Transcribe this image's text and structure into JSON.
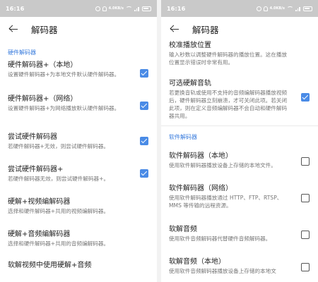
{
  "left": {
    "status": {
      "time": "16:16",
      "net": "4.0KB/s"
    },
    "title": "解码器",
    "section": "硬件解码器",
    "items": [
      {
        "title": "硬件解码器+（本地）",
        "summary": "设置硬件解码器+为本地文件默认硬件解码器。",
        "checked": true
      },
      {
        "title": "硬件解码器+（网络）",
        "summary": "设置硬件解码器+为网络播放默认硬件解码器。",
        "checked": true
      },
      {
        "title": "尝试硬件解码器",
        "summary": "若硬件解码器+无效，则尝试硬件解码器。",
        "checked": true
      },
      {
        "title": "尝试硬件解码器+",
        "summary": "若硬件解码器无效，则尝试硬件解码器+。",
        "checked": true
      },
      {
        "title": "硬解+视频编解码器",
        "summary": "选择和硬件解码器+共用的视频编解码器。"
      },
      {
        "title": "硬解+音频编解码器",
        "summary": "选择和硬件解码器+共用的音频编解码器。"
      },
      {
        "title": "软解视频中使用硬解+音频",
        "summary": ""
      }
    ]
  },
  "right": {
    "status": {
      "time": "16:16",
      "net": "4.0KB/s"
    },
    "title": "解码器",
    "top_items": [
      {
        "title": "校准播放位置",
        "summary": "输入秒数以调整硬件解码器的播放位置。这在播放位置显示错误时非常有用。"
      },
      {
        "title": "可选硬解音轨",
        "summary": "若更换音轨或使用不支持的音频编解码器播放视频后，硬件解码器立刻崩溃，才可关闭此项。若关闭此项，则在定义音频编解码器不会自动和硬件解码器共用。",
        "checked": true
      }
    ],
    "section": "软件解码器",
    "items": [
      {
        "title": "软件解码器（本地）",
        "summary": "使用软件解码器播放设备上存储的本地文件。",
        "checked": false
      },
      {
        "title": "软件解码器（网络）",
        "summary": "使用软件解码器播放通过 HTTP、FTP、RTSP、MMS 等传输的远程资源。",
        "checked": false
      },
      {
        "title": "软解音频",
        "summary": "使用软件音频解码器代替硬件音频解码器。",
        "checked": false
      },
      {
        "title": "软解音频（本地）",
        "summary": "使用软件音频解码器播放设备上存储的本地文",
        "checked": false
      }
    ]
  },
  "colors": {
    "accent": "#4a8be6",
    "section": "#3b7ddd",
    "status_bar": "#c9c9c9"
  },
  "icons": [
    "back-arrow-icon",
    "checkbox-icon",
    "wifi-icon",
    "signal-icon",
    "battery-icon",
    "alarm-icon",
    "bell-icon"
  ]
}
